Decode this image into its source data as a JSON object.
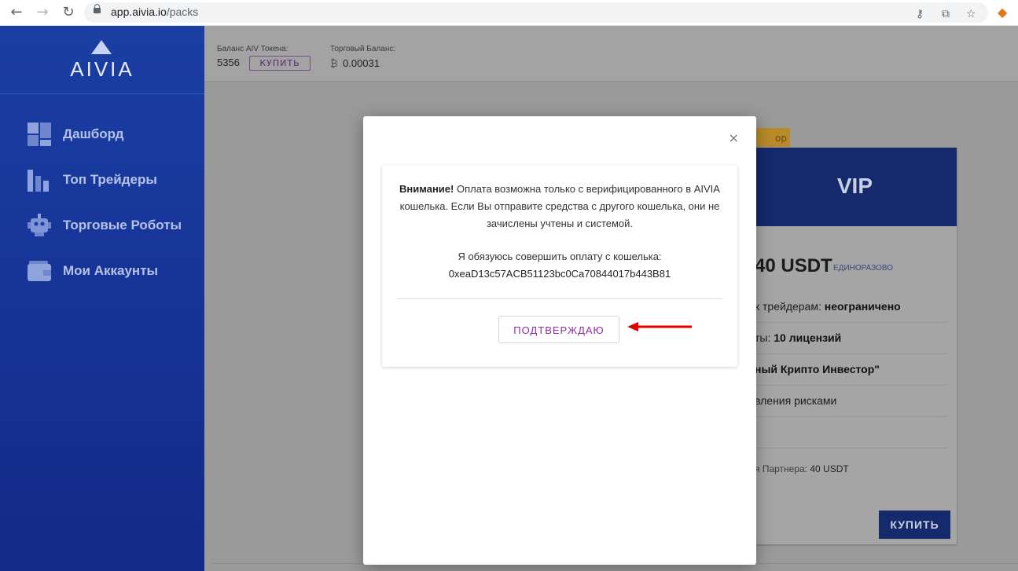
{
  "browser": {
    "url_host": "app.aivia.io",
    "url_path": "/packs"
  },
  "sidebar": {
    "logo": "AIVIA",
    "items": [
      {
        "label": "Дашборд",
        "icon": "dashboard-icon"
      },
      {
        "label": "Топ Трейдеры",
        "icon": "bar-chart-icon"
      },
      {
        "label": "Торговые Роботы",
        "icon": "robot-icon"
      },
      {
        "label": "Мои Аккаунты",
        "icon": "wallet-icon"
      }
    ]
  },
  "topbar": {
    "token_label": "Баланс AIV Токена:",
    "token_value": "5356",
    "buy_label": "КУПИТЬ",
    "trade_label": "Торговый Баланс:",
    "trade_currency": "₿",
    "trade_value": "0.00031"
  },
  "vip_card": {
    "ribbon": "ор",
    "title": "VIP",
    "price": "40 USDT",
    "price_note": "ЕДИНОРАЗОВО",
    "rows": [
      {
        "label": "к трейдерам: ",
        "value": "неограничено"
      },
      {
        "label": "ты: ",
        "value": "10 лицензий"
      },
      {
        "label": "",
        "value": "ный Крипто Инвестор\""
      },
      {
        "label": "вления рисками",
        "value": ""
      },
      {
        "label": "",
        "value": ""
      }
    ],
    "partner_label": "я Партнера: ",
    "partner_value": "40 USDT",
    "buy_label": "КУПИТЬ"
  },
  "modal": {
    "close_symbol": "×",
    "warning_bold": "Внимание!",
    "warning_text": " Оплата возможна только с верифицированного в AIVIA кошелька. Если Вы отправите средства с другого кошелька, они не зачислены учтены и системой.",
    "pledge": "Я обязуюсь совершить оплату с кошелька:",
    "wallet": "0xeaD13c57ACB51123bc0Ca70844017b443B81",
    "confirm_label": "ПОДТВЕРЖДАЮ"
  },
  "colors": {
    "sidebar": "#1a3ea3",
    "accent_purple": "#8e2da3",
    "arrow_red": "#e00000"
  }
}
